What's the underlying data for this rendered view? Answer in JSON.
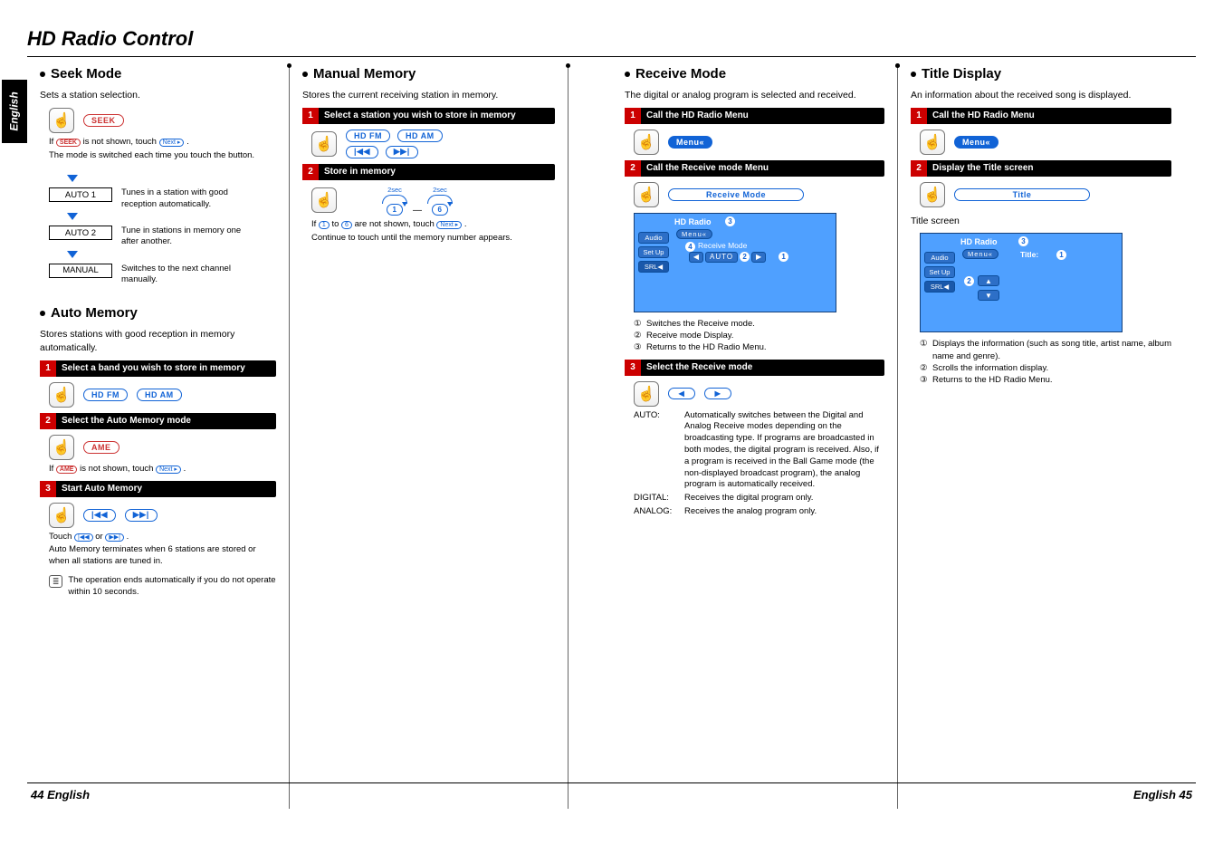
{
  "page_title": "HD Radio Control",
  "side_tab": "English",
  "footer_left": "44 English",
  "footer_right": "English 45",
  "btn": {
    "seek": "SEEK",
    "next": "Next ▸",
    "hd_fm": "HD FM",
    "hd_am": "HD AM",
    "prev_track": "|◀◀",
    "next_track": "▶▶|",
    "ame": "AME",
    "menu": "Menu«",
    "receive_mode": "Receive Mode",
    "title_btn": "Title",
    "one": "1",
    "six": "6",
    "hold": "2sec",
    "auto": "AUTO",
    "left": "◀",
    "right": "▶",
    "up": "▲",
    "down": "▼"
  },
  "seek": {
    "heading": "Seek Mode",
    "intro": "Sets a station selection.",
    "note_prefix": "If ",
    "note_mid": " is not shown, touch ",
    "note_suffix": ".",
    "note2": "The mode is switched each time you touch the button.",
    "modes": {
      "auto1": "AUTO 1",
      "auto1_desc": "Tunes in a station with good reception automatically.",
      "auto2": "AUTO 2",
      "auto2_desc": "Tune in stations in memory one after another.",
      "manual": "MANUAL",
      "manual_desc": "Switches to the next channel manually."
    }
  },
  "auto_memory": {
    "heading": "Auto Memory",
    "intro": "Stores stations with good reception in memory automatically.",
    "step1": "Select a band you wish to store in memory",
    "step2": "Select the Auto Memory mode",
    "note_prefix": "If ",
    "note_mid": " is not shown, touch ",
    "note_suffix": ".",
    "step3": "Start Auto Memory",
    "touch_prefix": "Touch ",
    "touch_mid": " or ",
    "touch_suffix": ".",
    "touch_note": "Auto Memory terminates when 6 stations are stored or when all stations are tuned in.",
    "timeout": "The operation ends automatically if you do not operate within 10 seconds."
  },
  "manual_memory": {
    "heading": "Manual Memory",
    "intro": "Stores the current receiving station in memory.",
    "step1": "Select a station you wish to store in memory",
    "step2": "Store in memory",
    "if_prefix": "If ",
    "to": " to ",
    "if_mid": " are not shown, touch ",
    "if_suffix": ".",
    "continue": "Continue to touch until the memory number appears."
  },
  "receive": {
    "heading": "Receive Mode",
    "intro": "The digital or analog program is selected and received.",
    "step1": "Call the HD Radio Menu",
    "step2": "Call the Receive mode Menu",
    "step3": "Select the Receive mode",
    "screen_title": "HD Radio",
    "screen_tab1": "Audio",
    "screen_tab2": "Set Up",
    "screen_tab3": "SRL◀",
    "screen_menu": "Menu«",
    "screen_rm": "Receive Mode",
    "ann1": "Switches the Receive mode.",
    "ann2": "Receive mode Display.",
    "ann3": "Returns to the HD Radio Menu.",
    "auto_key": "AUTO:",
    "auto_desc": "Automatically switches between the Digital and Analog Receive modes depending on the broadcasting type. If programs are broadcasted in both modes, the digital program is received. Also, if a program is received in the Ball Game mode (the non-displayed broadcast program), the analog program is automatically received.",
    "digital_key": "DIGITAL:",
    "digital_desc": "Receives the digital program only.",
    "analog_key": "ANALOG:",
    "analog_desc": "Receives the analog program only."
  },
  "title_display": {
    "heading": "Title Display",
    "intro": "An information about the received song is displayed.",
    "step1": "Call the HD Radio Menu",
    "step2": "Display the Title screen",
    "title_screen": "Title screen",
    "screen_title": "HD Radio",
    "screen_label": "Title:",
    "ann1": "Displays the information (such as song title, artist name, album name and genre).",
    "ann2": "Scrolls the information display.",
    "ann3": "Returns to the HD Radio Menu."
  }
}
